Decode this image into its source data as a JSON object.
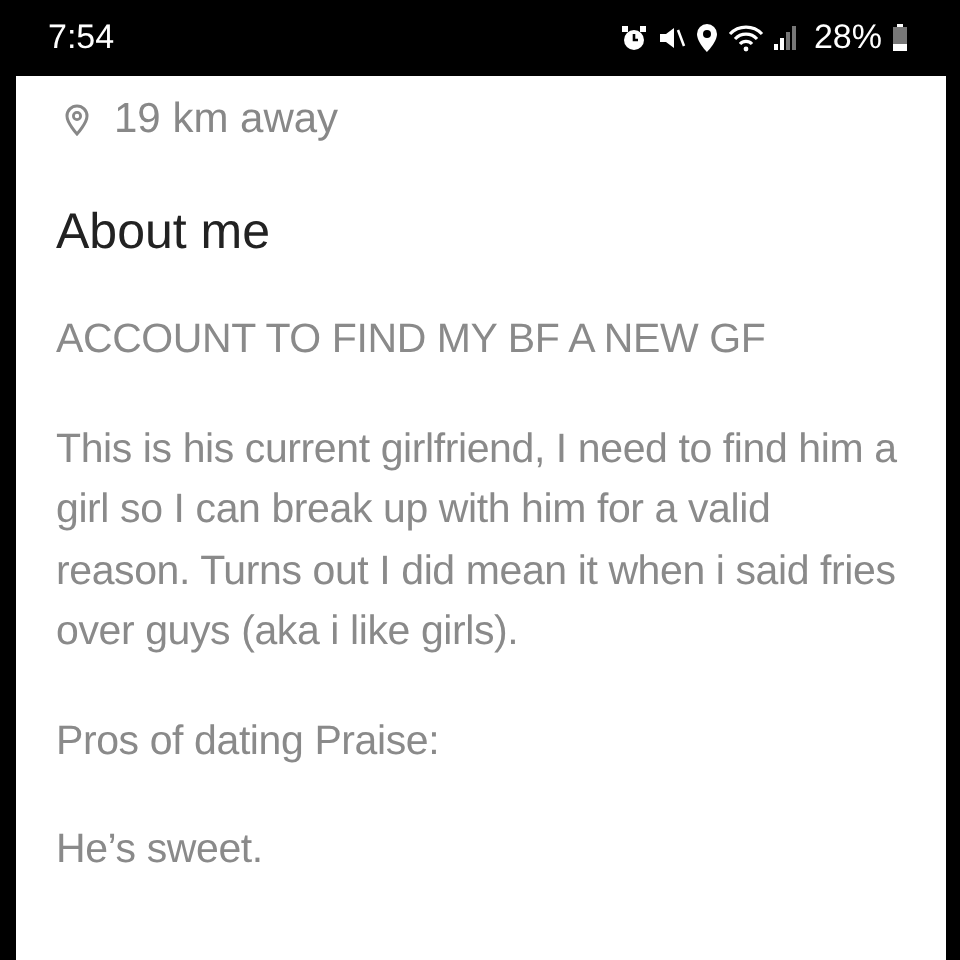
{
  "status_bar": {
    "time": "7:54",
    "battery": "28%"
  },
  "profile": {
    "distance": "19 km away",
    "section_title": "About me",
    "paragraphs": [
      "ACCOUNT TO FIND MY BF A NEW GF",
      "This is his current girlfriend, I need to find him a girl so I can break up with him for a valid reason. Turns out I did mean it when i said fries over guys (aka i like girls).",
      "Pros of dating Praise:",
      "He’s sweet."
    ]
  }
}
